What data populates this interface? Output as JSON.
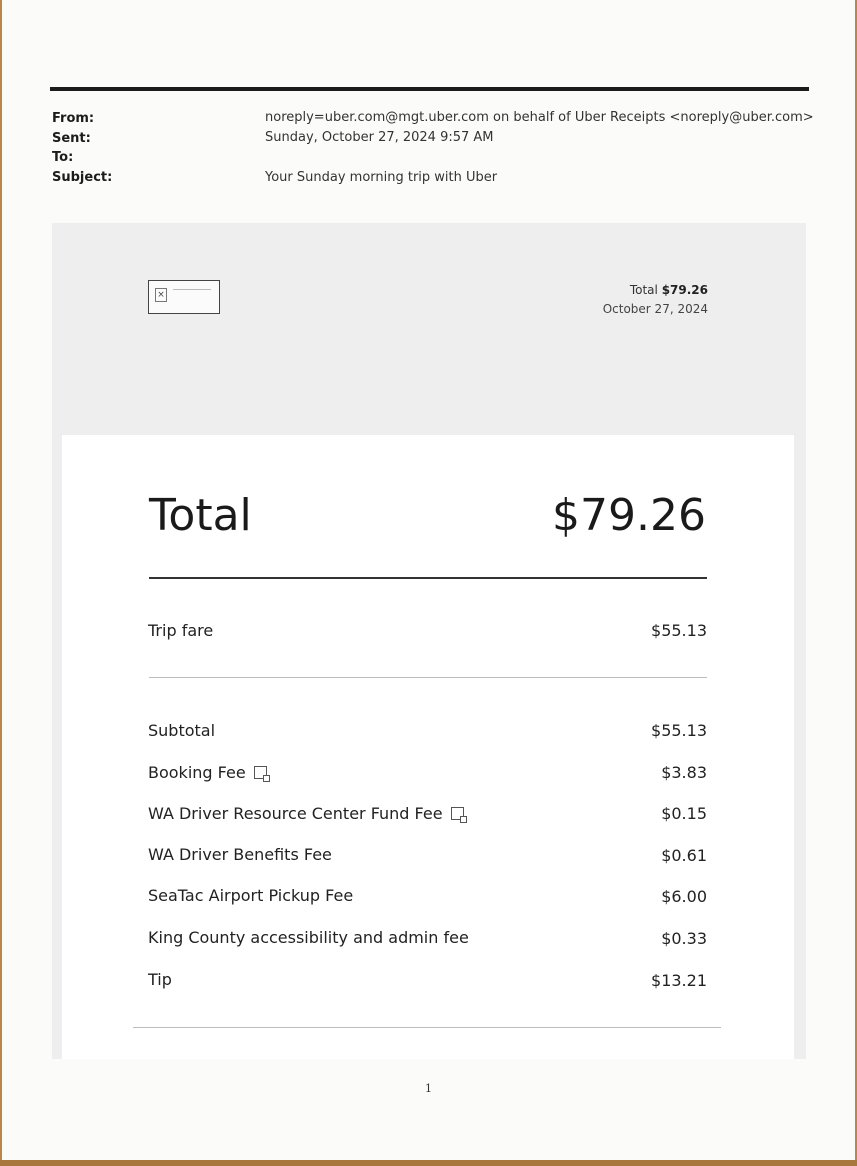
{
  "email": {
    "from_label": "From:",
    "from_value": "noreply=uber.com@mgt.uber.com on behalf of Uber Receipts <noreply@uber.com>",
    "sent_label": "Sent:",
    "sent_value": "Sunday, October 27, 2024 9:57 AM",
    "to_label": "To:",
    "to_value": "",
    "subject_label": "Subject:",
    "subject_value": "Your Sunday morning trip with Uber"
  },
  "banner": {
    "logo_icon": "broken-image-icon",
    "total_prefix": "Total ",
    "total_amount": "$79.26",
    "date": "October 27, 2024"
  },
  "receipt": {
    "total_label": "Total",
    "total_value": "$79.26",
    "trip_fare_label": "Trip fare",
    "trip_fare_value": "$55.13",
    "items": [
      {
        "label": "Subtotal",
        "value": "$55.13",
        "info_icon": false
      },
      {
        "label": "Booking Fee",
        "value": "$3.83",
        "info_icon": true
      },
      {
        "label": "WA Driver Resource Center Fund Fee",
        "value": "$0.15",
        "info_icon": true
      },
      {
        "label": "WA Driver Benefits Fee",
        "value": "$0.61",
        "info_icon": false
      },
      {
        "label": "SeaTac Airport Pickup Fee",
        "value": "$6.00",
        "info_icon": false
      },
      {
        "label": "King County accessibility and admin fee",
        "value": "$0.33",
        "info_icon": false
      },
      {
        "label": "Tip",
        "value": "$13.21",
        "info_icon": false
      }
    ]
  },
  "page_number": "1"
}
